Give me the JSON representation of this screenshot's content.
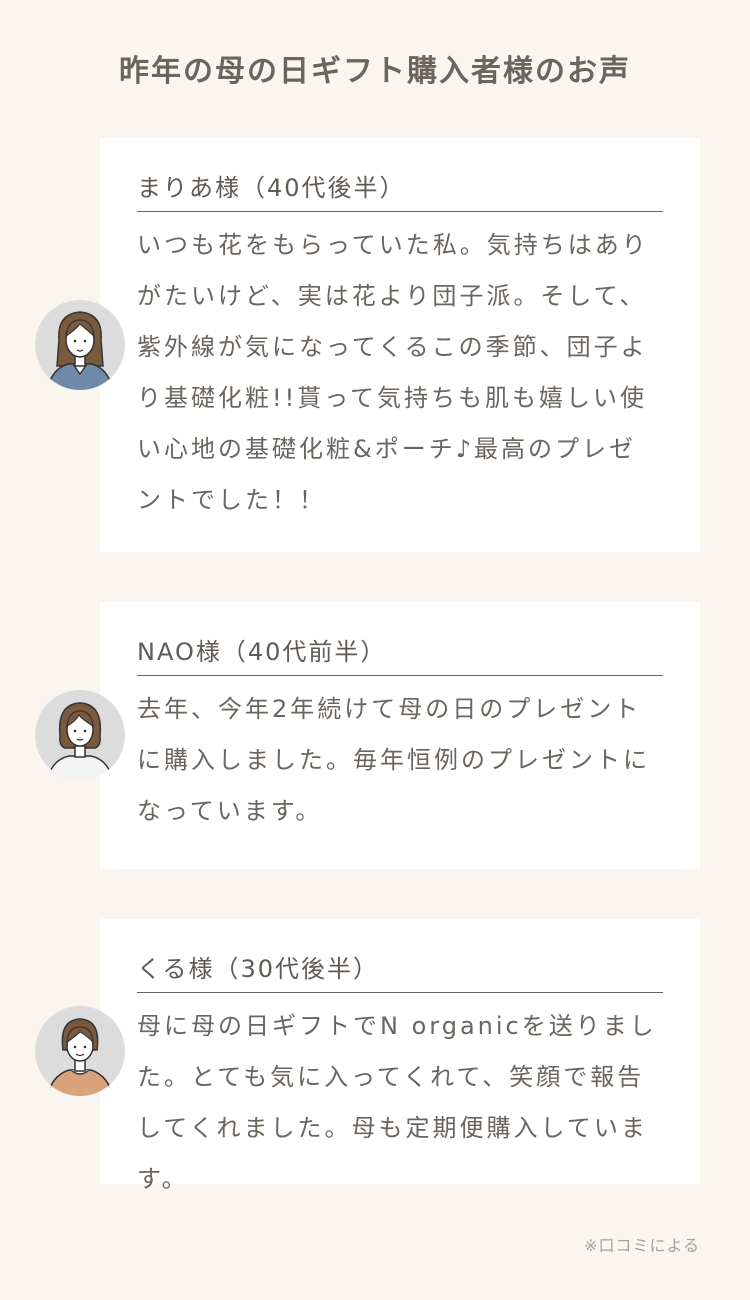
{
  "title": "昨年の母の日ギフト購入者様のお声",
  "reviews": [
    {
      "name": "まりあ様（40代後半）",
      "text": "いつも花をもらっていた私。気持ちはありがたいけど、実は花より団子派。そして、紫外線が気になってくるこの季節、団子より基礎化粧!!貰って気持ちも肌も嬉しい使い心地の基礎化粧&ポーチ♪最高のプレゼントでした！！",
      "avatar": "woman-long-hair-blue-top-avatar"
    },
    {
      "name": "NAO様（40代前半）",
      "text": "去年、今年2年続けて母の日のプレゼントに購入しました。毎年恒例のプレゼントになっています。",
      "avatar": "woman-bob-hair-white-top-avatar"
    },
    {
      "name": "くる様（30代後半）",
      "text": "母に母の日ギフトでN organicを送りました。とても気に入ってくれて、笑顔で報告してくれました。母も定期便購入しています。",
      "avatar": "woman-short-hair-orange-top-avatar"
    }
  ],
  "footnote": "※口コミによる"
}
